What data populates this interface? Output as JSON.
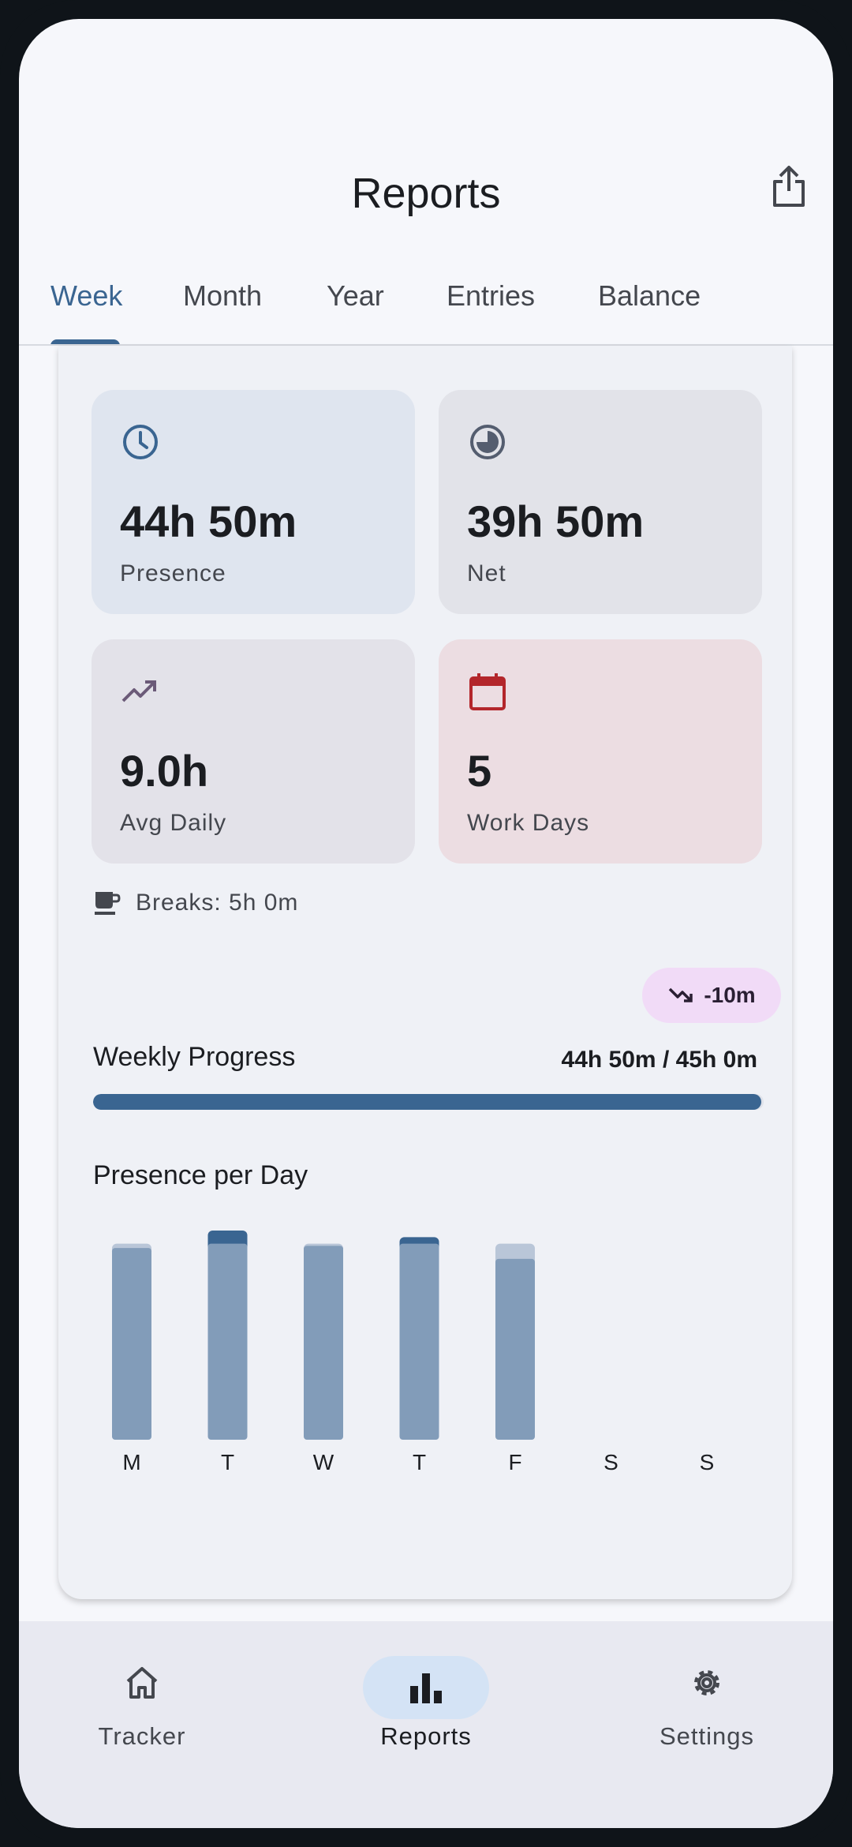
{
  "header": {
    "title": "Reports",
    "share_icon": "share-icon"
  },
  "tabs": [
    {
      "label": "Week",
      "active": true
    },
    {
      "label": "Month",
      "active": false
    },
    {
      "label": "Year",
      "active": false
    },
    {
      "label": "Entries",
      "active": false
    },
    {
      "label": "Balance",
      "active": false
    }
  ],
  "stats": {
    "presence": {
      "value": "44h 50m",
      "label": "Presence",
      "icon": "clock-icon",
      "color": "#3a6591"
    },
    "net": {
      "value": "39h 50m",
      "label": "Net",
      "icon": "pie-chart-icon",
      "color": "#545d6f"
    },
    "avg_daily": {
      "value": "9.0h",
      "label": "Avg Daily",
      "icon": "trending-up-icon",
      "color": "#6b5a78"
    },
    "work_days": {
      "value": "5",
      "label": "Work Days",
      "icon": "calendar-icon",
      "color": "#b3262b"
    }
  },
  "breaks": {
    "text": "Breaks: 5h 0m",
    "icon": "coffee-icon"
  },
  "delta": {
    "text": "-10m",
    "icon": "trending-down-icon"
  },
  "weekly_progress": {
    "label": "Weekly Progress",
    "value_text": "44h 50m / 45h 0m",
    "fraction": 0.996
  },
  "chart_data": {
    "type": "bar",
    "title": "Presence per Day",
    "categories": [
      "M",
      "T",
      "W",
      "T",
      "F",
      "S",
      "S"
    ],
    "series": [
      {
        "values": [
          9.0,
          9.0,
          9.0,
          9.0,
          9.0,
          0,
          0
        ]
      },
      {
        "values": [
          8.8,
          9.6,
          8.9,
          9.3,
          8.3,
          0,
          0
        ]
      }
    ],
    "ylim": [
      0,
      10
    ]
  },
  "colors": {
    "accent": "#3a6591",
    "bar_target": "#b9c6d8",
    "bar_presence": "#829cb9"
  },
  "bottom_nav": [
    {
      "label": "Tracker",
      "icon": "home-icon",
      "active": false
    },
    {
      "label": "Reports",
      "icon": "bar-chart-icon",
      "active": true
    },
    {
      "label": "Settings",
      "icon": "gear-icon",
      "active": false
    }
  ]
}
